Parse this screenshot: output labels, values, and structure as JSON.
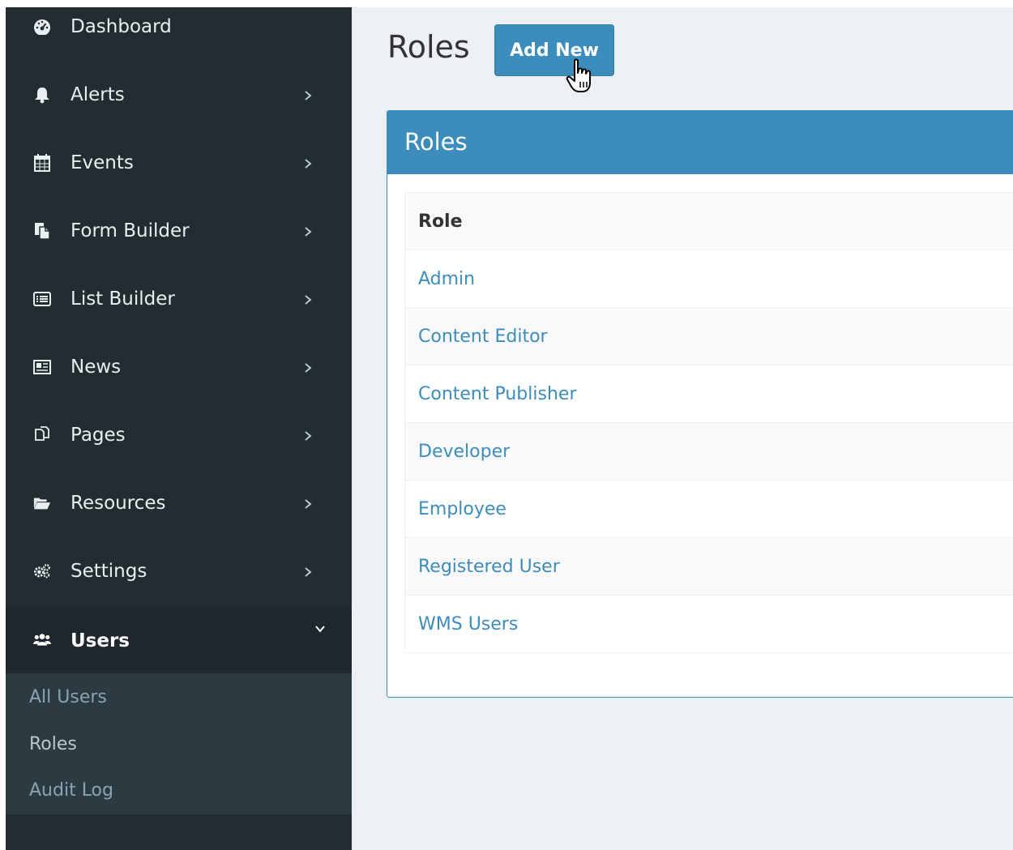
{
  "sidebar": {
    "items": [
      {
        "label": "Dashboard",
        "icon": "dashboard-icon"
      },
      {
        "label": "Alerts",
        "icon": "bell-icon"
      },
      {
        "label": "Events",
        "icon": "calendar-icon"
      },
      {
        "label": "Form Builder",
        "icon": "form-copy-icon"
      },
      {
        "label": "List Builder",
        "icon": "list-icon"
      },
      {
        "label": "News",
        "icon": "newspaper-icon"
      },
      {
        "label": "Pages",
        "icon": "pages-icon"
      },
      {
        "label": "Resources",
        "icon": "folder-open-icon"
      },
      {
        "label": "Settings",
        "icon": "cogs-icon"
      },
      {
        "label": "Users",
        "icon": "users-icon",
        "expanded": true
      }
    ],
    "users_submenu": [
      {
        "label": "All Users"
      },
      {
        "label": "Roles",
        "current": true
      },
      {
        "label": "Audit Log"
      }
    ]
  },
  "main": {
    "page_title": "Roles",
    "add_button_label": "Add New",
    "box": {
      "title": "Roles",
      "table": {
        "column_header": "Role",
        "rows": [
          "Admin",
          "Content Editor",
          "Content Publisher",
          "Developer",
          "Employee",
          "Registered User",
          "WMS Users"
        ]
      }
    }
  },
  "colors": {
    "sidebar_bg": "#222d32",
    "sidebar_active_bg": "#1e282c",
    "submenu_bg": "#2c3b41",
    "content_bg": "#ecf0f5",
    "primary": "#3c8dbc",
    "link": "#3c8dbc"
  }
}
